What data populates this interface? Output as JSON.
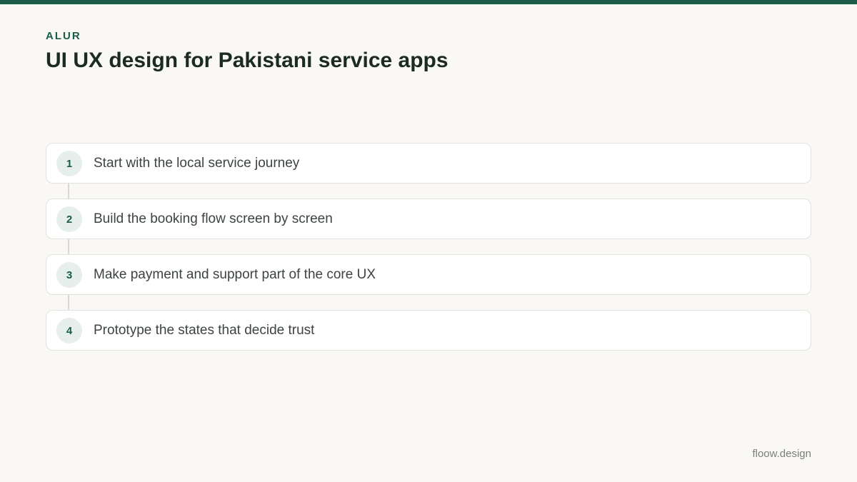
{
  "colors": {
    "accent": "#1a5c48",
    "background": "#f9f8f5",
    "card": "#ffffff",
    "number_badge": "#e6efeb"
  },
  "header": {
    "eyebrow": "ALUR",
    "title": "UI UX design for Pakistani service apps"
  },
  "steps": [
    {
      "number": "1",
      "text": "Start with the local service journey"
    },
    {
      "number": "2",
      "text": "Build the booking flow screen by screen"
    },
    {
      "number": "3",
      "text": "Make payment and support part of the core UX"
    },
    {
      "number": "4",
      "text": "Prototype the states that decide trust"
    }
  ],
  "footer": {
    "brand": "floow.design"
  }
}
